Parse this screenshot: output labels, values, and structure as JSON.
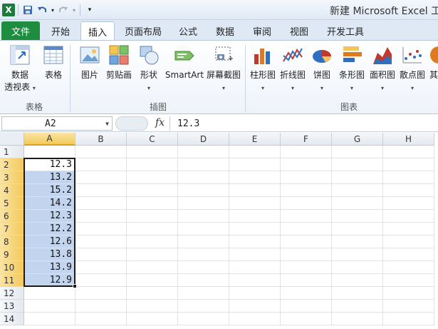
{
  "window": {
    "title": "新建 Microsoft Excel 工作"
  },
  "qat": {
    "logo": "X"
  },
  "tabs": [
    {
      "label": "文件"
    },
    {
      "label": "开始"
    },
    {
      "label": "插入"
    },
    {
      "label": "页面布局"
    },
    {
      "label": "公式"
    },
    {
      "label": "数据"
    },
    {
      "label": "审阅"
    },
    {
      "label": "视图"
    },
    {
      "label": "开发工具"
    }
  ],
  "ribbon": {
    "pivot_line1": "数据",
    "pivot_line2": "透视表",
    "table": "表格",
    "picture": "图片",
    "clipart": "剪贴画",
    "shapes": "形状",
    "smartart": "SmartArt",
    "screenshot": "屏幕截图",
    "column": "柱形图",
    "line": "折线图",
    "pie": "饼图",
    "bar": "条形图",
    "area": "面积图",
    "scatter": "散点图",
    "other": "其",
    "group_tables": "表格",
    "group_illustrations": "插图",
    "group_charts": "图表"
  },
  "formula_bar": {
    "name_box": "A2",
    "fx": "fx",
    "value": "12.3"
  },
  "grid": {
    "columns": [
      "A",
      "B",
      "C",
      "D",
      "E",
      "F",
      "G",
      "H"
    ],
    "rows": [
      "1",
      "2",
      "3",
      "4",
      "5",
      "6",
      "7",
      "8",
      "9",
      "10",
      "11",
      "12",
      "13",
      "14"
    ],
    "colA_values": [
      "",
      "12.3",
      "13.2",
      "15.2",
      "14.2",
      "12.3",
      "12.2",
      "12.6",
      "13.8",
      "13.9",
      "12.9",
      "",
      "",
      ""
    ]
  },
  "colors": {
    "file_tab": "#1e8d3f",
    "selection": "#c3d5ee",
    "header_selected": "#f2c95b"
  }
}
